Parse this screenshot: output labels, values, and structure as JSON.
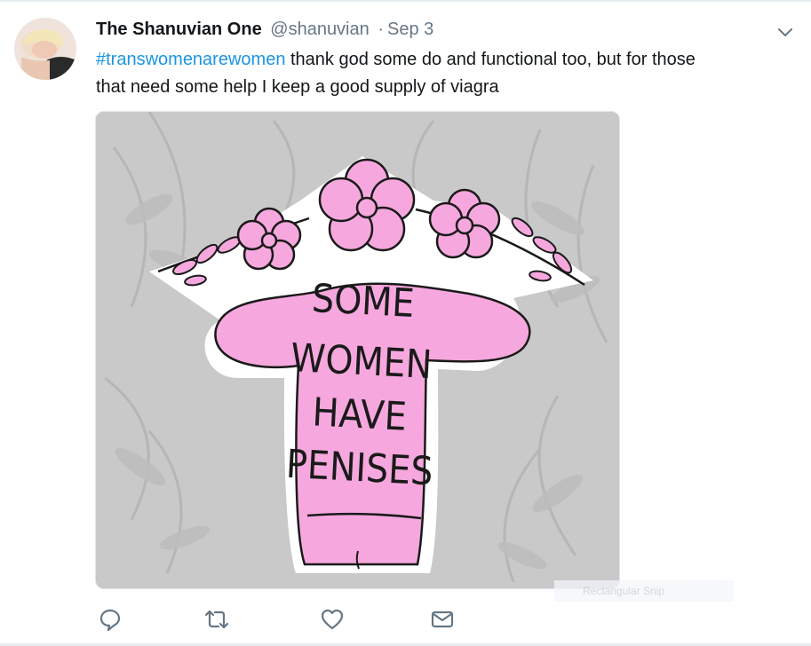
{
  "tweet": {
    "display_name": "The Shanuvian One",
    "handle": "@shanuvian",
    "separator": "·",
    "timestamp": "Sep 3",
    "hashtag": "#transwomenarewomen",
    "body_line1": " thank god some do and functional too, but for those",
    "body_line2": "that need some help I keep a good supply of viagra"
  },
  "media": {
    "sticker_text": [
      "SOME",
      "WOMEN",
      "HAVE",
      "PENISES"
    ],
    "sticker_color": "#f6a8de",
    "background_color": "#c9c9c9"
  },
  "overlay": {
    "snip_label": "Rectangular Snip"
  },
  "colors": {
    "link": "#1b95e0",
    "muted": "#657786",
    "text": "#14171a"
  },
  "icons": {
    "reply": "reply-icon",
    "retweet": "retweet-icon",
    "like": "heart-icon",
    "dm": "envelope-icon",
    "menu": "chevron-down-icon"
  }
}
